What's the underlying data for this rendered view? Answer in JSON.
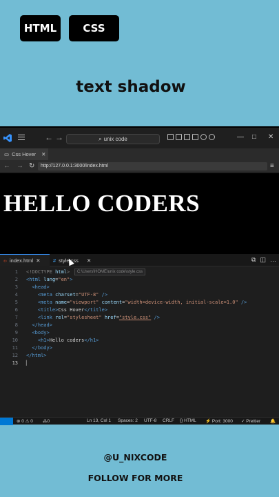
{
  "header": {
    "tag_html": "HTML",
    "tag_css": "CSS",
    "headline": "text shadow"
  },
  "titlebar": {
    "search_text": "unix code",
    "minimize": "—",
    "maximize": "□",
    "close": "✕"
  },
  "browser": {
    "tab_label": "Css Hover",
    "url": "http://127.0.0.1:3000/index.html",
    "preview_heading": "HELLO CODERS"
  },
  "editor": {
    "tabs": [
      {
        "label": "index.html",
        "icon": "html-file-icon"
      },
      {
        "label": "style.css",
        "icon": "css-file-icon"
      }
    ],
    "tooltip": "C:\\Users\\HOME\\unix code\\style.css",
    "line_numbers": [
      "1",
      "2",
      "3",
      "4",
      "5",
      "6",
      "7",
      "8",
      "9",
      "10",
      "11",
      "12",
      "13"
    ]
  },
  "statusbar": {
    "problems": "⊗ 0 ⚠ 0",
    "ports": "⁂0",
    "position": "Ln 13, Col 1",
    "spaces": "Spaces: 2",
    "encoding": "UTF-8",
    "eol": "CRLF",
    "language": "{} HTML",
    "port": "⚡ Port: 3000",
    "formatter": "✓ Prettier"
  },
  "footer": {
    "handle": "@U_NIXCODE",
    "cta": "FOLLOW FOR MORE"
  },
  "colors": {
    "background": "#72bcd4",
    "editor_bg": "#1e1e1e",
    "accent": "#0078d4"
  }
}
